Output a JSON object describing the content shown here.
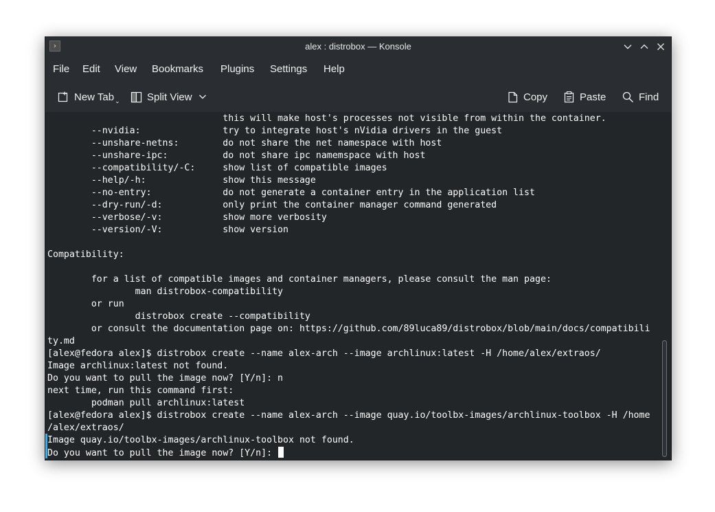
{
  "window": {
    "title": "alex : distrobox — Konsole"
  },
  "menubar": {
    "items": [
      "File",
      "Edit",
      "View",
      "Bookmarks",
      "Plugins",
      "Settings",
      "Help"
    ]
  },
  "toolbar": {
    "new_tab_label": "New Tab",
    "split_view_label": "Split View",
    "copy_label": "Copy",
    "paste_label": "Paste",
    "find_label": "Find"
  },
  "icons": {
    "app": "konsole-icon",
    "minimize": "chevron-down-icon",
    "maximize": "chevron-up-icon",
    "close": "close-icon",
    "new_tab": "new-tab-icon",
    "split_view": "split-view-icon",
    "copy": "copy-icon",
    "paste": "paste-icon",
    "find": "search-icon"
  },
  "terminal": {
    "lines": [
      "                                this will make host's processes not visible from within the container.",
      "        --nvidia:               try to integrate host's nVidia drivers in the guest",
      "        --unshare-netns:        do not share the net namespace with host",
      "        --unshare-ipc:          do not share ipc namemspace with host",
      "        --compatibility/-C:     show list of compatible images",
      "        --help/-h:              show this message",
      "        --no-entry:             do not generate a container entry in the application list",
      "        --dry-run/-d:           only print the container manager command generated",
      "        --verbose/-v:           show more verbosity",
      "        --version/-V:           show version",
      "",
      "Compatibility:",
      "",
      "        for a list of compatible images and container managers, please consult the man page:",
      "                man distrobox-compatibility",
      "        or run",
      "                distrobox create --compatibility",
      "        or consult the documentation page on: https://github.com/89luca89/distrobox/blob/main/docs/compatibili",
      "ty.md",
      "[alex@fedora alex]$ distrobox create --name alex-arch --image archlinux:latest -H /home/alex/extraos/",
      "Image archlinux:latest not found.",
      "Do you want to pull the image now? [Y/n]: n",
      "next time, run this command first:",
      "        podman pull archlinux:latest",
      "[alex@fedora alex]$ distrobox create --name alex-arch --image quay.io/toolbx-images/archlinux-toolbox -H /home",
      "/alex/extraos/",
      "Image quay.io/toolbx-images/archlinux-toolbox not found.",
      "Do you want to pull the image now? [Y/n]: "
    ]
  },
  "colors": {
    "window_bg": "#2a2e32",
    "terminal_bg": "#232629",
    "terminal_fg": "#fcfcfc",
    "accent": "#3daee9"
  }
}
